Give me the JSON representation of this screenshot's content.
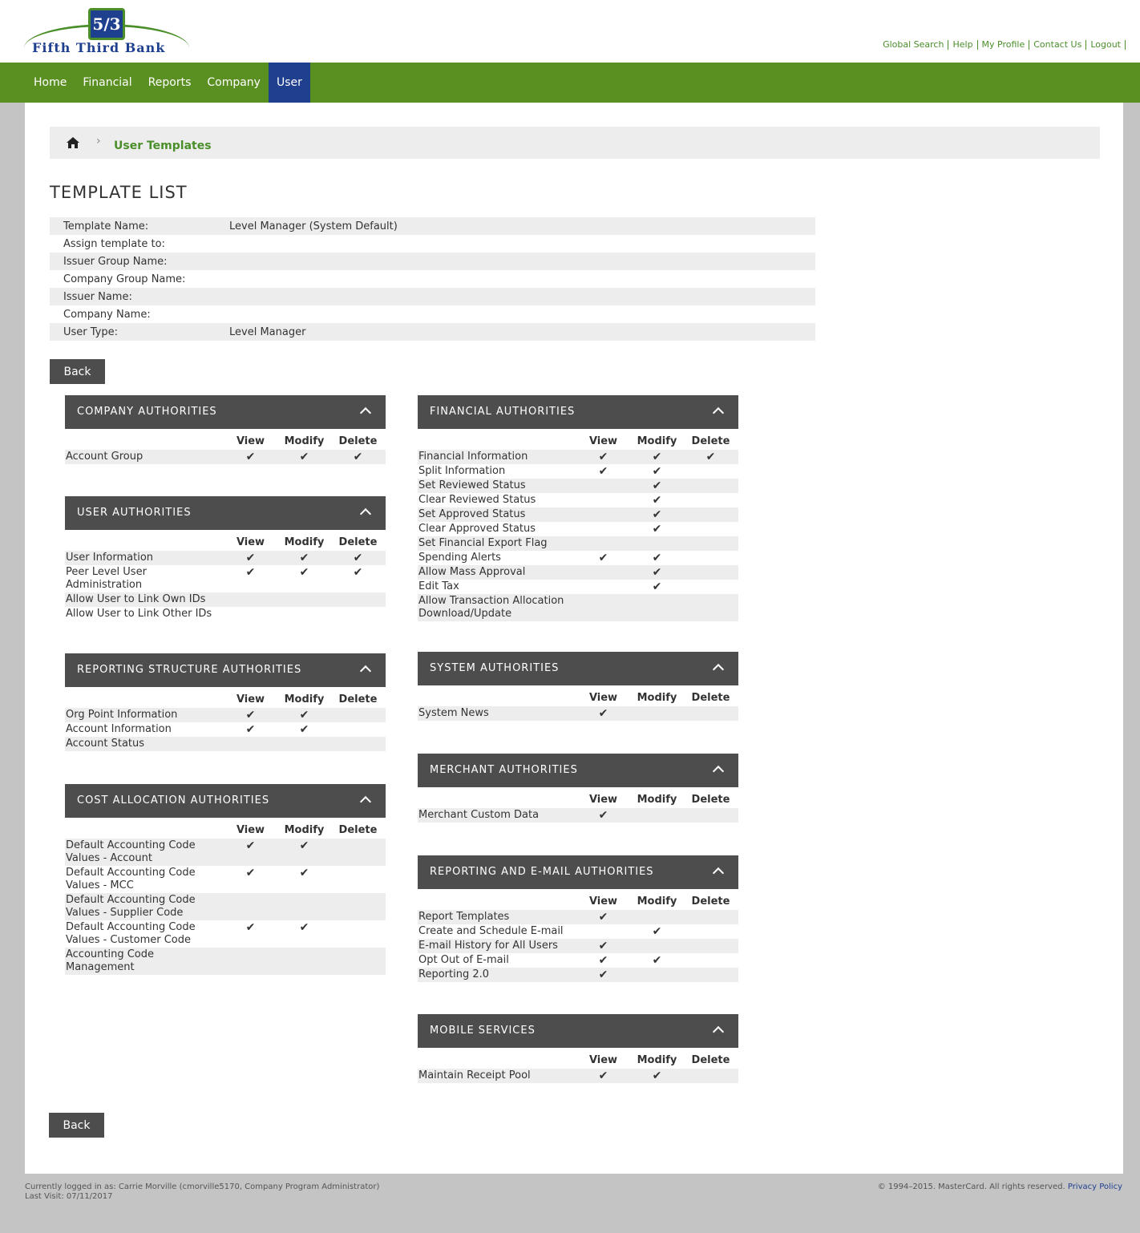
{
  "brand": {
    "logo_mark": "5/3",
    "name": "Fifth Third Bank"
  },
  "toplinks": [
    "Global Search",
    "Help",
    "My Profile",
    "Contact Us",
    "Logout"
  ],
  "nav": [
    {
      "label": "Home",
      "active": false
    },
    {
      "label": "Financial",
      "active": false
    },
    {
      "label": "Reports",
      "active": false
    },
    {
      "label": "Company",
      "active": false
    },
    {
      "label": "User",
      "active": true
    }
  ],
  "breadcrumb": {
    "home_icon": "home-icon",
    "separator": "›",
    "current": "User Templates"
  },
  "page_title": "TEMPLATE LIST",
  "info": [
    {
      "label": "Template Name:",
      "value": "Level Manager (System Default)"
    },
    {
      "label": "Assign template to:",
      "value": ""
    },
    {
      "label": "Issuer Group Name:",
      "value": ""
    },
    {
      "label": "Company Group Name:",
      "value": ""
    },
    {
      "label": "Issuer Name:",
      "value": ""
    },
    {
      "label": "Company Name:",
      "value": ""
    },
    {
      "label": "User Type:",
      "value": "Level Manager"
    }
  ],
  "back_label": "Back",
  "columns": [
    "View",
    "Modify",
    "Delete"
  ],
  "check": "✔",
  "panels": {
    "company": {
      "title": "COMPANY AUTHORITIES",
      "rows": [
        {
          "label": "Account Group",
          "view": true,
          "modify": true,
          "delete": true
        }
      ]
    },
    "user": {
      "title": "USER AUTHORITIES",
      "rows": [
        {
          "label": "User Information",
          "view": true,
          "modify": true,
          "delete": true
        },
        {
          "label": "Peer Level User Administration",
          "view": true,
          "modify": true,
          "delete": true
        },
        {
          "label": "Allow User to Link Own IDs",
          "view": false,
          "modify": false,
          "delete": false
        },
        {
          "label": "Allow User to Link Other IDs",
          "view": false,
          "modify": false,
          "delete": false
        }
      ]
    },
    "reporting_structure": {
      "title": "REPORTING STRUCTURE AUTHORITIES",
      "rows": [
        {
          "label": "Org Point Information",
          "view": true,
          "modify": true,
          "delete": false
        },
        {
          "label": "Account Information",
          "view": true,
          "modify": true,
          "delete": false
        },
        {
          "label": "Account Status",
          "view": false,
          "modify": false,
          "delete": false
        }
      ]
    },
    "cost_allocation": {
      "title": "COST ALLOCATION AUTHORITIES",
      "rows": [
        {
          "label": "Default Accounting Code Values - Account",
          "view": true,
          "modify": true,
          "delete": false
        },
        {
          "label": "Default Accounting Code Values - MCC",
          "view": true,
          "modify": true,
          "delete": false
        },
        {
          "label": "Default Accounting Code Values - Supplier Code",
          "view": false,
          "modify": false,
          "delete": false
        },
        {
          "label": "Default Accounting Code Values - Customer Code",
          "view": true,
          "modify": true,
          "delete": false
        },
        {
          "label": "Accounting Code Management",
          "view": false,
          "modify": false,
          "delete": false
        }
      ]
    },
    "financial": {
      "title": "FINANCIAL AUTHORITIES",
      "rows": [
        {
          "label": "Financial Information",
          "view": true,
          "modify": true,
          "delete": true
        },
        {
          "label": "Split Information",
          "view": true,
          "modify": true,
          "delete": false
        },
        {
          "label": "Set Reviewed Status",
          "view": false,
          "modify": true,
          "delete": false
        },
        {
          "label": "Clear Reviewed Status",
          "view": false,
          "modify": true,
          "delete": false
        },
        {
          "label": "Set Approved Status",
          "view": false,
          "modify": true,
          "delete": false
        },
        {
          "label": "Clear Approved Status",
          "view": false,
          "modify": true,
          "delete": false
        },
        {
          "label": "Set Financial Export Flag",
          "view": false,
          "modify": false,
          "delete": false
        },
        {
          "label": "Spending Alerts",
          "view": true,
          "modify": true,
          "delete": false
        },
        {
          "label": "Allow Mass Approval",
          "view": false,
          "modify": true,
          "delete": false
        },
        {
          "label": "Edit Tax",
          "view": false,
          "modify": true,
          "delete": false
        },
        {
          "label": "Allow Transaction Allocation Download/Update",
          "view": false,
          "modify": false,
          "delete": false
        }
      ]
    },
    "system": {
      "title": "SYSTEM AUTHORITIES",
      "rows": [
        {
          "label": "System News",
          "view": true,
          "modify": false,
          "delete": false
        }
      ]
    },
    "merchant": {
      "title": "MERCHANT AUTHORITIES",
      "rows": [
        {
          "label": "Merchant Custom Data",
          "view": true,
          "modify": false,
          "delete": false
        }
      ]
    },
    "reporting_email": {
      "title": "REPORTING AND E-MAIL AUTHORITIES",
      "rows": [
        {
          "label": "Report Templates",
          "view": true,
          "modify": false,
          "delete": false
        },
        {
          "label": "Create and Schedule E-mail",
          "view": false,
          "modify": true,
          "delete": false
        },
        {
          "label": "E-mail History for All Users",
          "view": true,
          "modify": false,
          "delete": false
        },
        {
          "label": "Opt Out of E-mail",
          "view": true,
          "modify": true,
          "delete": false
        },
        {
          "label": "Reporting 2.0",
          "view": true,
          "modify": false,
          "delete": false
        }
      ]
    },
    "mobile": {
      "title": "MOBILE SERVICES",
      "rows": [
        {
          "label": "Maintain Receipt Pool",
          "view": true,
          "modify": true,
          "delete": false
        }
      ]
    }
  },
  "footer": {
    "logged_in": "Currently logged in as: Carrie Morville (cmorville5170, Company Program Administrator)",
    "last_visit": "Last Visit: 07/11/2017",
    "copyright": "© 1994–2015. MasterCard. All rights reserved.",
    "privacy": "Privacy Policy"
  },
  "colors": {
    "nav_green": "#5a9021",
    "active_blue": "#1f3f8f",
    "panel_header": "#4d4d4d",
    "link_green": "#4a8f2a"
  }
}
